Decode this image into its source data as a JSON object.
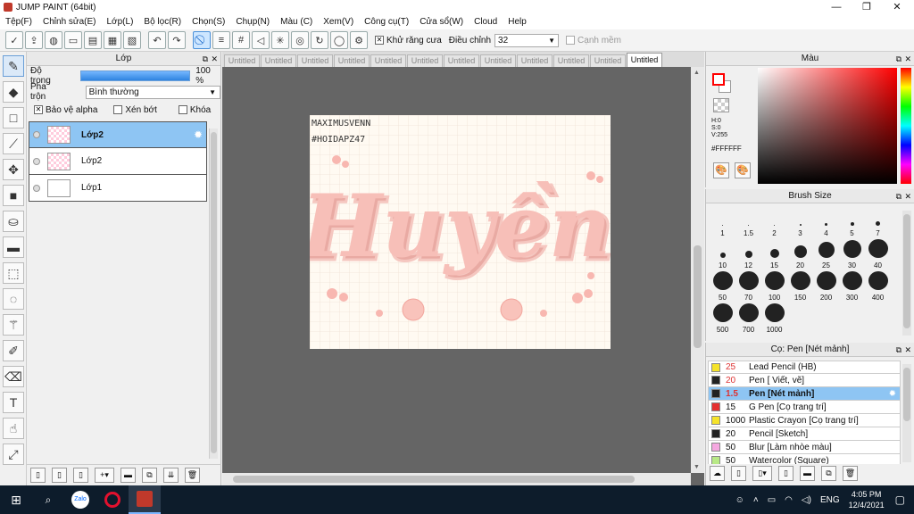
{
  "window": {
    "title": "JUMP PAINT (64bit)"
  },
  "menu": [
    "Tệp(F)",
    "Chỉnh sửa(E)",
    "Lớp(L)",
    "Bộ lọc(R)",
    "Chọn(S)",
    "Chụp(N)",
    "Màu (C)",
    "Xem(V)",
    "Công cụ(T)",
    "Cửa sổ(W)",
    "Cloud",
    "Help"
  ],
  "toolbar": {
    "antialias_label": "Khử răng cưa",
    "adjust_label": "Điều chỉnh",
    "adjust_value": "32",
    "smooth_label": "Cạnh mềm"
  },
  "layer_panel": {
    "title": "Lớp",
    "opacity_label": "Độ trong",
    "opacity_value": "100 %",
    "opacity_fraction": 1.0,
    "blend_label": "Pha trộn",
    "blend_value": "Bình thường",
    "protect_alpha": "Bảo vệ alpha",
    "clipping": "Xén bớt",
    "lock": "Khóa",
    "layers": [
      {
        "name": "Lớp2",
        "active": true
      },
      {
        "name": "Lớp2",
        "active": false
      },
      {
        "name": "Lớp1",
        "active": false
      }
    ]
  },
  "tabs": [
    "Untitled",
    "Untitled",
    "Untitled",
    "Untitled",
    "Untitled",
    "Untitled",
    "Untitled",
    "Untitled",
    "Untitled",
    "Untitled",
    "Untitled",
    "Untitled"
  ],
  "artwork": {
    "watermark1": "MAXIMUSVENN",
    "watermark2": "#HOIDAPZ47",
    "word": "Huyền"
  },
  "color_panel": {
    "title": "Màu",
    "h": "H:0",
    "s": "S:0",
    "v": "V:255",
    "hex": "#FFFFFF",
    "primary": "#ff0000",
    "secondary": "#ffffff"
  },
  "brush_size_panel": {
    "title": "Brush Size",
    "sizes": [
      {
        "label": "1",
        "d": 1
      },
      {
        "label": "1.5",
        "d": 1
      },
      {
        "label": "2",
        "d": 1.5
      },
      {
        "label": "3",
        "d": 2
      },
      {
        "label": "4",
        "d": 3
      },
      {
        "label": "5",
        "d": 4
      },
      {
        "label": "7",
        "d": 5
      },
      {
        "label": "10",
        "d": 6
      },
      {
        "label": "12",
        "d": 8
      },
      {
        "label": "15",
        "d": 10
      },
      {
        "label": "20",
        "d": 14
      },
      {
        "label": "25",
        "d": 18
      },
      {
        "label": "30",
        "d": 20
      },
      {
        "label": "40",
        "d": 22
      },
      {
        "label": "50",
        "d": 22
      },
      {
        "label": "70",
        "d": 22
      },
      {
        "label": "100",
        "d": 22
      },
      {
        "label": "150",
        "d": 22
      },
      {
        "label": "200",
        "d": 22
      },
      {
        "label": "300",
        "d": 22
      },
      {
        "label": "400",
        "d": 22
      },
      {
        "label": "500",
        "d": 22
      },
      {
        "label": "700",
        "d": 22
      },
      {
        "label": "1000",
        "d": 22
      }
    ]
  },
  "pen_panel": {
    "title": "Cọ: Pen [Nét mảnh]",
    "brushes": [
      {
        "size": "25",
        "name": "Lead Pencil (HB)",
        "color": "#f5e32a",
        "red": true,
        "active": false
      },
      {
        "size": "20",
        "name": "Pen [ Viết, vẽ]",
        "color": "#222222",
        "red": true,
        "active": false
      },
      {
        "size": "1.5",
        "name": "Pen [Nét mảnh]",
        "color": "#222222",
        "red": true,
        "active": true
      },
      {
        "size": "15",
        "name": "G Pen [Cọ trang trí]",
        "color": "#e53030",
        "red": false,
        "active": false
      },
      {
        "size": "1000",
        "name": "Plastic Crayon [Cọ trang trí]",
        "color": "#f5e32a",
        "red": false,
        "active": false
      },
      {
        "size": "20",
        "name": "Pencil [Sketch]",
        "color": "#222222",
        "red": false,
        "active": false
      },
      {
        "size": "50",
        "name": "Blur [Làm nhòe màu]",
        "color": "#f5a8e0",
        "red": false,
        "active": false
      },
      {
        "size": "50",
        "name": "Watercolor (Square)",
        "color": "#b8e986",
        "red": false,
        "active": false
      }
    ]
  },
  "taskbar": {
    "lang": "ENG",
    "time": "4:05 PM",
    "date": "12/4/2021"
  }
}
